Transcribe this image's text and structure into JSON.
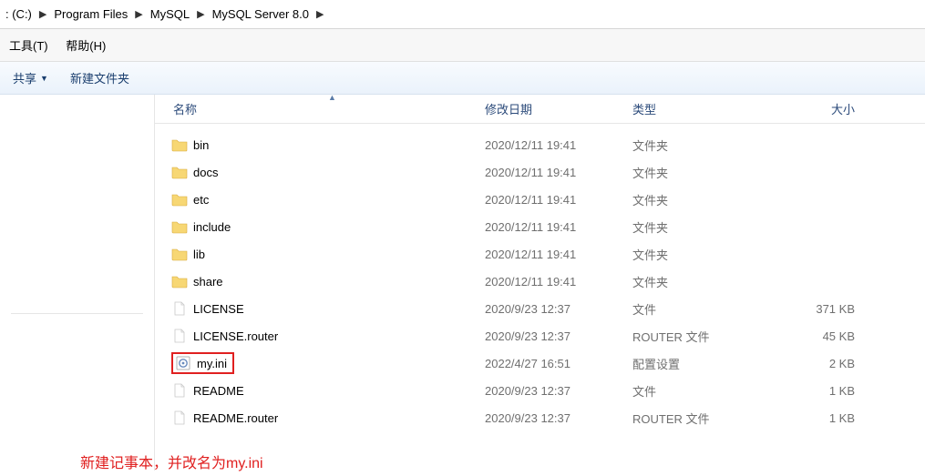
{
  "breadcrumb": {
    "items": [
      ": (C:)",
      "Program Files",
      "MySQL",
      "MySQL Server 8.0"
    ]
  },
  "menu": {
    "tools": "工具(T)",
    "help": "帮助(H)"
  },
  "toolbar": {
    "share": "共享",
    "new_folder": "新建文件夹"
  },
  "columns": {
    "name": "名称",
    "date": "修改日期",
    "type": "类型",
    "size": "大小"
  },
  "files": [
    {
      "name": "bin",
      "date": "2020/12/11 19:41",
      "type": "文件夹",
      "size": "",
      "icon": "folder"
    },
    {
      "name": "docs",
      "date": "2020/12/11 19:41",
      "type": "文件夹",
      "size": "",
      "icon": "folder"
    },
    {
      "name": "etc",
      "date": "2020/12/11 19:41",
      "type": "文件夹",
      "size": "",
      "icon": "folder"
    },
    {
      "name": "include",
      "date": "2020/12/11 19:41",
      "type": "文件夹",
      "size": "",
      "icon": "folder"
    },
    {
      "name": "lib",
      "date": "2020/12/11 19:41",
      "type": "文件夹",
      "size": "",
      "icon": "folder"
    },
    {
      "name": "share",
      "date": "2020/12/11 19:41",
      "type": "文件夹",
      "size": "",
      "icon": "folder"
    },
    {
      "name": "LICENSE",
      "date": "2020/9/23 12:37",
      "type": "文件",
      "size": "371 KB",
      "icon": "file"
    },
    {
      "name": "LICENSE.router",
      "date": "2020/9/23 12:37",
      "type": "ROUTER 文件",
      "size": "45 KB",
      "icon": "file"
    },
    {
      "name": "my.ini",
      "date": "2022/4/27 16:51",
      "type": "配置设置",
      "size": "2 KB",
      "icon": "ini",
      "highlight": true
    },
    {
      "name": "README",
      "date": "2020/9/23 12:37",
      "type": "文件",
      "size": "1 KB",
      "icon": "file"
    },
    {
      "name": "README.router",
      "date": "2020/9/23 12:37",
      "type": "ROUTER 文件",
      "size": "1 KB",
      "icon": "file"
    }
  ],
  "annotation": "新建记事本，并改名为my.ini"
}
